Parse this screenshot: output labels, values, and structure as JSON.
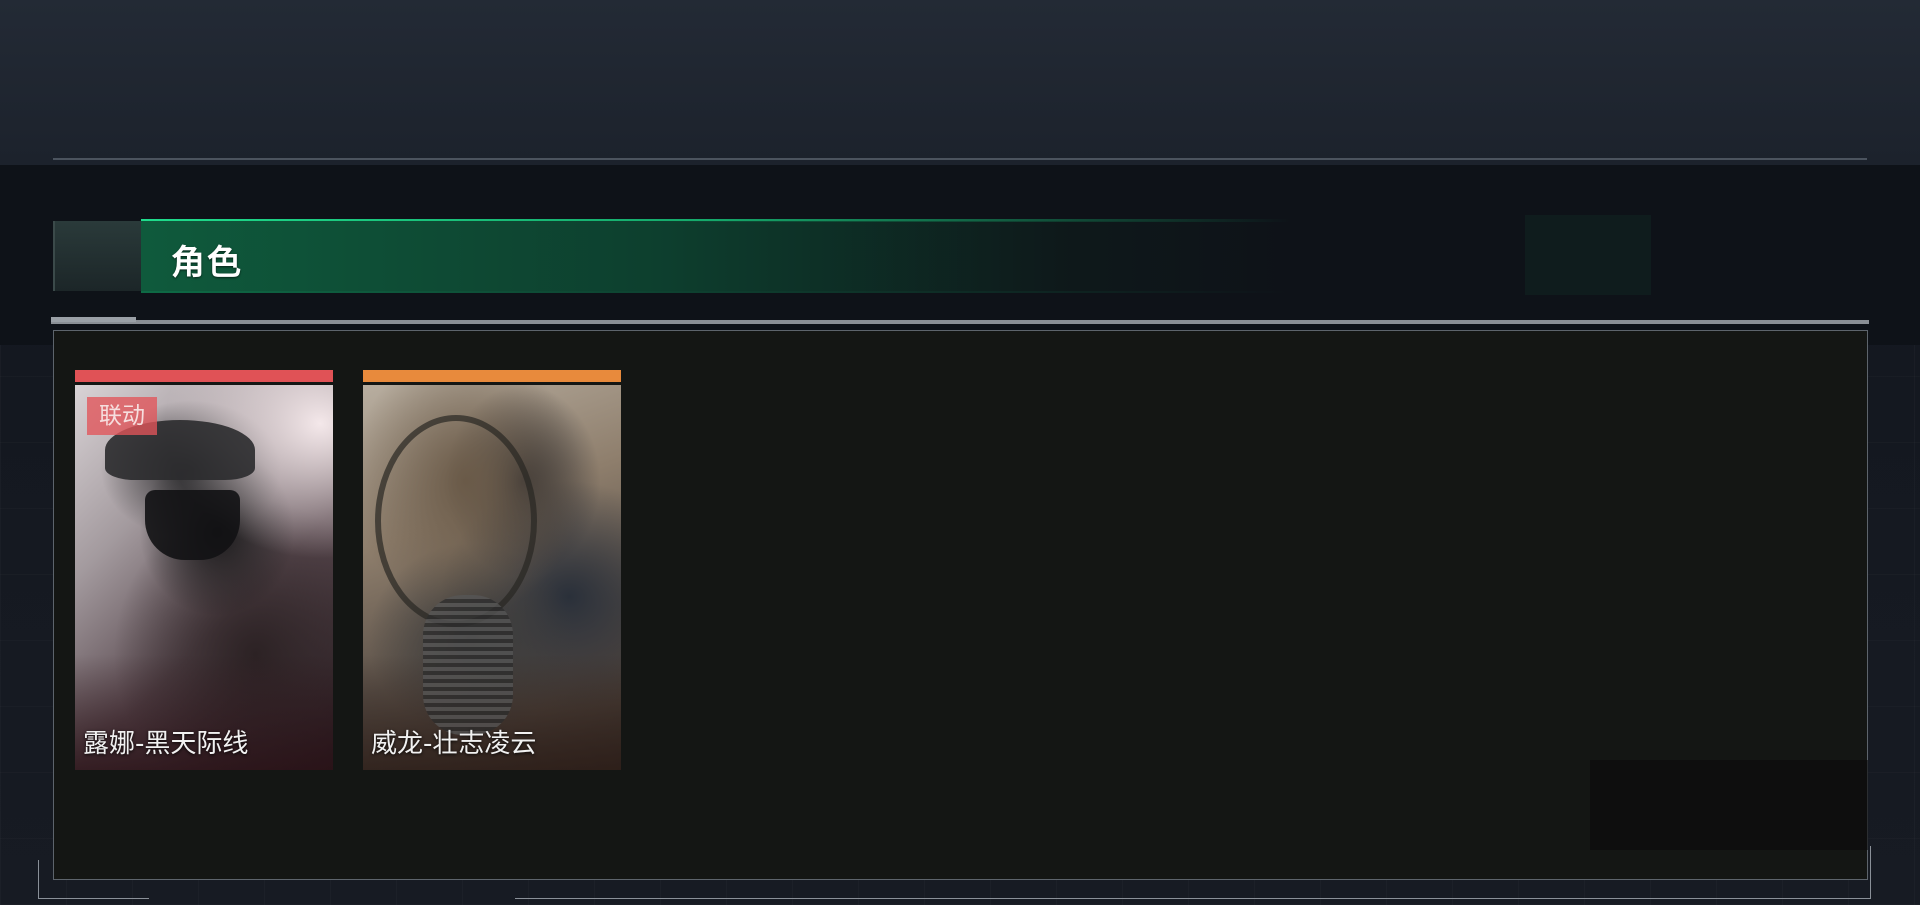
{
  "section": {
    "title": "角色"
  },
  "characters": [
    {
      "name": "露娜-黑天际线",
      "badge": "联动",
      "rarity_color": "#e05256"
    },
    {
      "name": "威龙-壮志凌云",
      "badge": "",
      "rarity_color": "#e88a3c"
    }
  ],
  "colors": {
    "accent_green": "#1fdc8c",
    "panel_bg": "#141614"
  }
}
